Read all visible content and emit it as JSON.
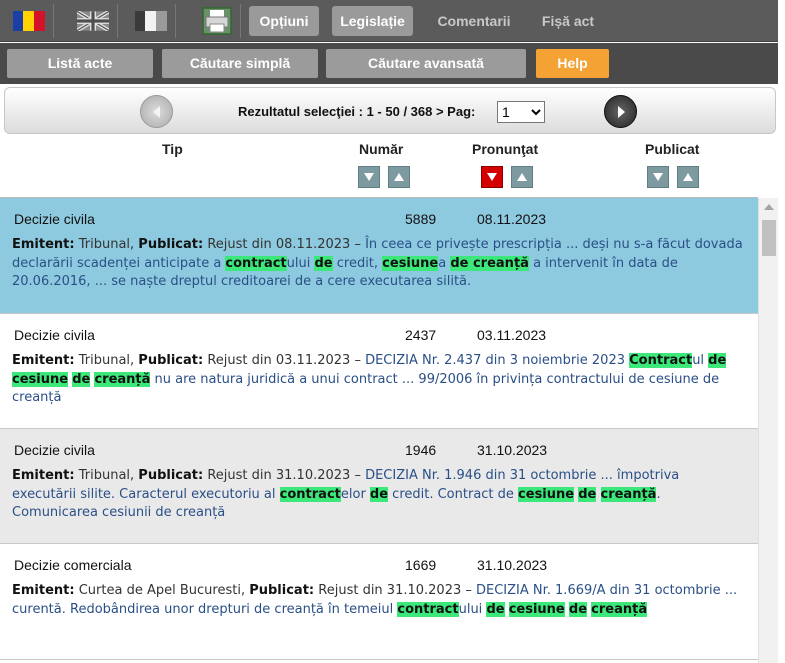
{
  "topbar": {
    "tabs": [
      {
        "label": "Opțiuni",
        "active": true
      },
      {
        "label": "Legislație",
        "active": true
      },
      {
        "label": "Comentarii",
        "active": false
      },
      {
        "label": "Fișă act",
        "active": false
      }
    ]
  },
  "navbar": {
    "buttons": [
      {
        "label": "Listă acte"
      },
      {
        "label": "Căutare simplă"
      },
      {
        "label": "Căutare avansată"
      },
      {
        "label": "Help"
      }
    ]
  },
  "pager": {
    "text": "Rezultatul selecţiei : 1 - 50 / 368 > Pag:",
    "page": "1"
  },
  "columns": {
    "tip": "Tip",
    "numar": "Număr",
    "pronuntat": "Pronunţat",
    "publicat": "Publicat"
  },
  "colors": {
    "selected_row": "#8ecadf",
    "highlight": "#3de87b",
    "help": "#f5a234"
  },
  "results": [
    {
      "tip": "Decizie civila",
      "numar": "5889",
      "data": "08.11.2023",
      "emitent": "Tribunal",
      "publicat": "Rejust din 08.11.2023",
      "snippet": [
        {
          "t": "În ceea ce privește prescripția ... deși nu s-a făcut dovada declarării scadenței anticipate a "
        },
        {
          "t": "contract",
          "hl": true
        },
        {
          "t": "ului "
        },
        {
          "t": "de",
          "hl": true
        },
        {
          "t": " credit, "
        },
        {
          "t": "cesiune",
          "hl": true
        },
        {
          "t": "a "
        },
        {
          "t": "de creanță",
          "hl": true
        },
        {
          "t": " a intervenit în data de 20.06.2016, ... se naște dreptul creditoarei de a cere executarea silită."
        }
      ]
    },
    {
      "tip": "Decizie civila",
      "numar": "2437",
      "data": "03.11.2023",
      "emitent": "Tribunal",
      "publicat": "Rejust din 03.11.2023",
      "snippet": [
        {
          "t": "DECIZIA Nr. 2.437 din 3 noiembrie 2023 "
        },
        {
          "t": "Contract",
          "hl": true
        },
        {
          "t": "ul "
        },
        {
          "t": "de",
          "hl": true
        },
        {
          "t": " "
        },
        {
          "t": "cesiune",
          "hl": true
        },
        {
          "t": " "
        },
        {
          "t": "de",
          "hl": true
        },
        {
          "t": " "
        },
        {
          "t": "creanță",
          "hl": true
        },
        {
          "t": " nu are natura juridică a unui contract ... 99/2006 în privința contractului de cesiune de creanță"
        }
      ]
    },
    {
      "tip": "Decizie civila",
      "numar": "1946",
      "data": "31.10.2023",
      "emitent": "Tribunal",
      "publicat": "Rejust din 31.10.2023",
      "snippet": [
        {
          "t": "DECIZIA Nr. 1.946 din 31 octombrie ... împotriva executării silite. Caracterul executoriu al "
        },
        {
          "t": "contract",
          "hl": true
        },
        {
          "t": "elor "
        },
        {
          "t": "de",
          "hl": true
        },
        {
          "t": " credit. Contract de "
        },
        {
          "t": "cesiune",
          "hl": true
        },
        {
          "t": " "
        },
        {
          "t": "de",
          "hl": true
        },
        {
          "t": " "
        },
        {
          "t": "creanță",
          "hl": true
        },
        {
          "t": ". Comunicarea cesiunii de creanță"
        }
      ]
    },
    {
      "tip": "Decizie comerciala",
      "numar": "1669",
      "data": "31.10.2023",
      "emitent": "Curtea de Apel Bucuresti",
      "publicat": "Rejust din 31.10.2023",
      "snippet": [
        {
          "t": "DECIZIA Nr. 1.669/A din 31 octombrie ... curentă. Redobândirea unor drepturi de creanță în temeiul "
        },
        {
          "t": "contract",
          "hl": true
        },
        {
          "t": "ului "
        },
        {
          "t": "de",
          "hl": true
        },
        {
          "t": " "
        },
        {
          "t": "cesiune",
          "hl": true
        },
        {
          "t": " "
        },
        {
          "t": "de",
          "hl": true
        },
        {
          "t": " "
        },
        {
          "t": "creanță",
          "hl": true
        }
      ]
    }
  ]
}
